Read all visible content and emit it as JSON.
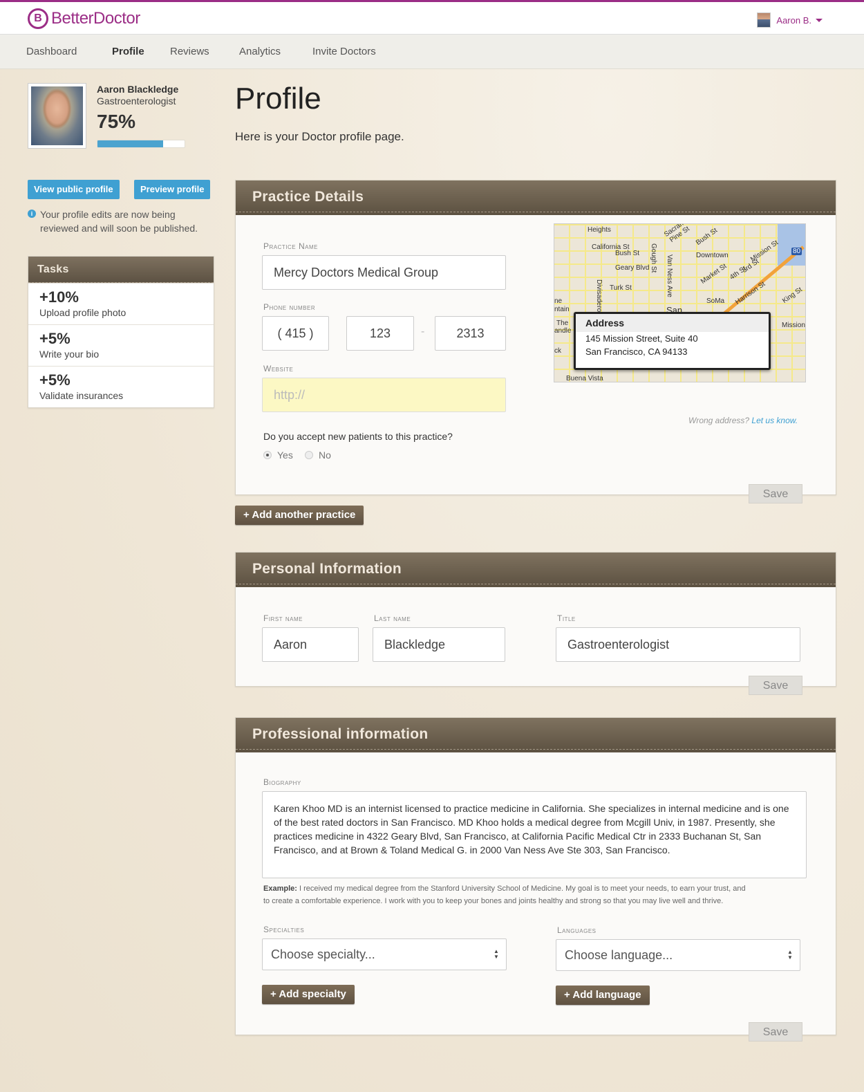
{
  "brand": {
    "name_bold": "Better",
    "name_light": "Doctor",
    "mark": "B",
    "color": "#9b2d86"
  },
  "user_menu": {
    "name": "Aaron B."
  },
  "nav": {
    "items": [
      {
        "label": "Dashboard"
      },
      {
        "label": "Profile"
      },
      {
        "label": "Reviews"
      },
      {
        "label": "Analytics"
      },
      {
        "label": "Invite Doctors"
      }
    ],
    "active": "Profile"
  },
  "profile": {
    "name": "Aaron Blackledge",
    "specialty": "Gastroenterologist",
    "completion_label": "75%",
    "completion_pct": 75
  },
  "sidebar": {
    "view_public_label": "View public profile",
    "preview_label": "Preview profile",
    "info_icon": "i",
    "info_text": "Your profile edits are now being reviewed and will soon be published."
  },
  "tasks": {
    "title": "Tasks",
    "items": [
      {
        "pct": "+10%",
        "label": "Upload profile photo"
      },
      {
        "pct": "+5%",
        "label": "Write your bio"
      },
      {
        "pct": "+5%",
        "label": "Validate insurances"
      }
    ]
  },
  "page": {
    "title": "Profile",
    "subtitle": "Here is your Doctor profile page."
  },
  "practice": {
    "title": "Practice Details",
    "name_label": "Practice Name",
    "name_value": "Mercy Doctors Medical Group",
    "phone_label": "Phone number",
    "phone_area": "( 415 )",
    "phone_prefix": "123",
    "phone_line": "2313",
    "phone_sep": "-",
    "website_label": "Website",
    "website_placeholder": "http://",
    "question": "Do you accept new patients to this practice?",
    "yes_label": "Yes",
    "no_label": "No",
    "accepts_new": "Yes",
    "save_label": "Save",
    "map": {
      "popup_title": "Address",
      "address_line1": "145 Mission Street, Suite 40",
      "address_line2": "San Francisco, CA 94133",
      "labels": [
        "Heights",
        "Sacramento St",
        "California St",
        "Pine St",
        "Bush St",
        "Bush St",
        "Downtown",
        "Geary Blvd",
        "Gough St",
        "Van Ness Ave",
        "Divisadero",
        "Turk St",
        "Market St",
        "SoMa",
        "Harrison St",
        "Mission St",
        "3rd St",
        "4th St",
        "King St",
        "San",
        "Mission",
        "Buena Vista",
        "ntain",
        "The",
        "andle",
        "ck",
        "ne",
        "80"
      ],
      "highway_shield": "80"
    },
    "wrong_address": "Wrong address?",
    "let_us_know": "Let us know."
  },
  "add_practice_label": "+ Add another practice",
  "personal": {
    "title": "Personal Information",
    "first_label": "First name",
    "first_value": "Aaron",
    "last_label": "Last name",
    "last_value": "Blackledge",
    "title_label": "Title",
    "title_value": "Gastroenterologist",
    "save_label": "Save"
  },
  "professional": {
    "title": "Professional information",
    "bio_label": "Biography",
    "bio_value": "Karen Khoo MD is an internist licensed to practice medicine in California. She specializes in internal medicine and is one of the best rated doctors in San Francisco. MD Khoo holds a medical degree from Mcgill Univ, in 1987. Presently, she practices medicine in 4322 Geary Blvd, San Francisco, at California Pacific Medical Ctr in 2333 Buchanan St, San Francisco, and at Brown & Toland Medical G. in 2000 Van Ness Ave Ste 303, San Francisco.",
    "example_label": "Example:",
    "example_text": "I received my medical degree from the Stanford University School of Medicine.  My goal is to meet your needs, to earn your trust, and to create a comfortable experience.  I work with you to keep your bones and joints healthy and strong so that you may live well and thrive.",
    "specialties_label": "Specialties",
    "specialty_placeholder": "Choose specialty...",
    "add_specialty_label": "+ Add specialty",
    "languages_label": "Languages",
    "language_placeholder": "Choose language...",
    "add_language_label": "+ Add language",
    "save_label": "Save"
  }
}
